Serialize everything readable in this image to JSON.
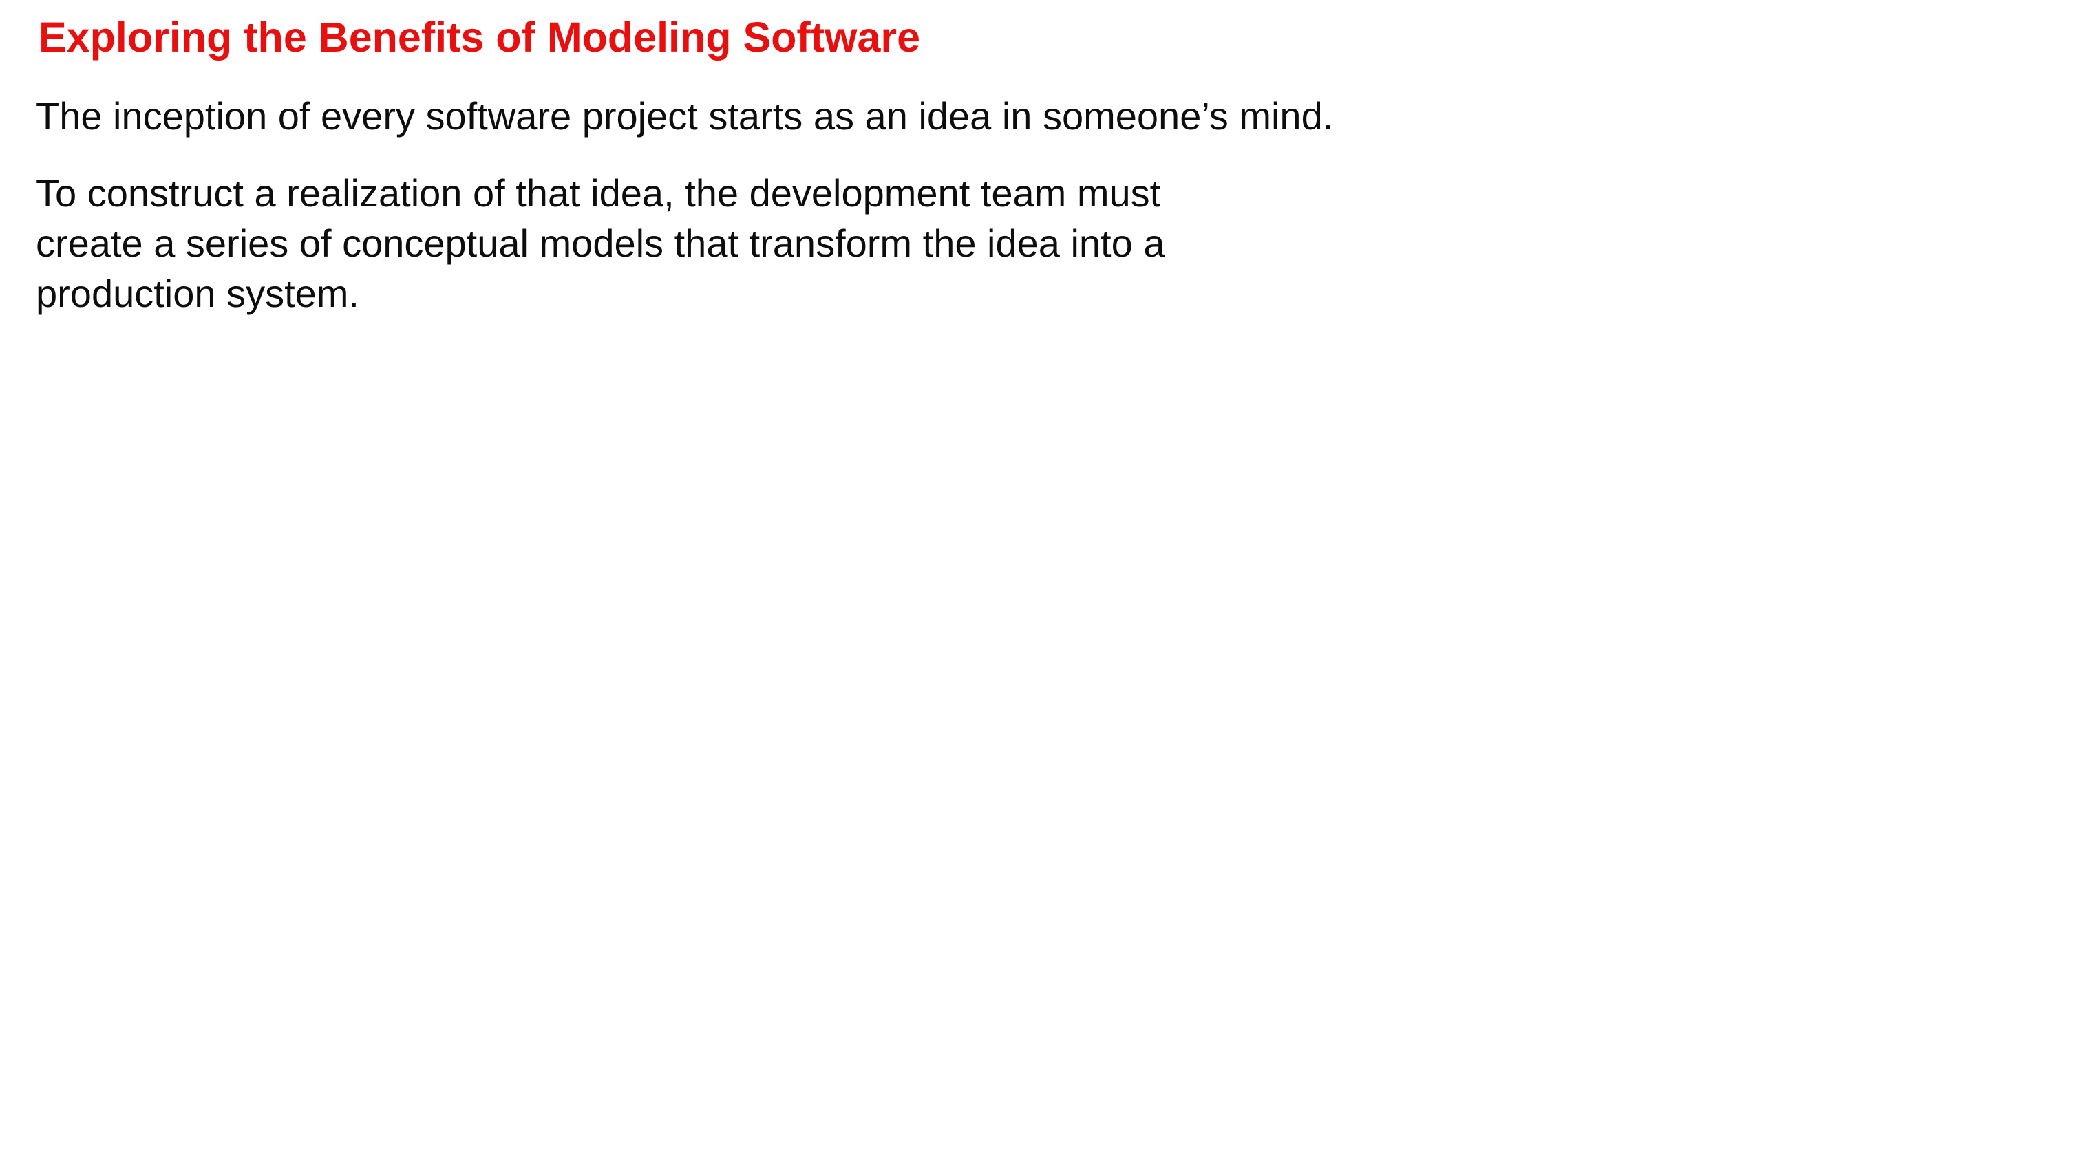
{
  "slide": {
    "title": "Exploring the Benefits of Modeling Software",
    "title_color": "#e80f0f",
    "paragraphs": [
      {
        "lines": [
          "The inception of every software project starts as an idea in someone’s mind."
        ]
      },
      {
        "lines": [
          "To construct a realization of that idea, the development team must",
          "create a series of conceptual models that transform the idea into a",
          "production system."
        ]
      }
    ]
  }
}
